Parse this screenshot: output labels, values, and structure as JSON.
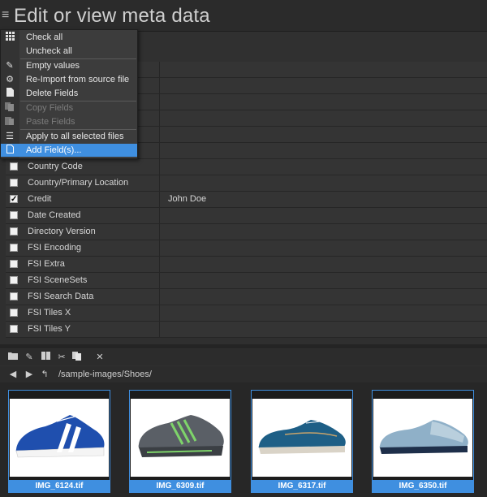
{
  "header": {
    "menu_icon": "hamburger-icon",
    "title": "Edit or view meta data"
  },
  "table": {
    "rows": [
      {
        "name": "",
        "value": "",
        "checked": false
      },
      {
        "name": "",
        "value": "",
        "checked": false
      },
      {
        "name": "",
        "value": "",
        "checked": false
      },
      {
        "name": "",
        "value": "",
        "checked": false
      },
      {
        "name": "",
        "value": "",
        "checked": false
      },
      {
        "name": "",
        "value": "",
        "checked": false
      },
      {
        "name": "Country Code",
        "value": "",
        "checked": false
      },
      {
        "name": "Country/Primary Location",
        "value": "",
        "checked": false
      },
      {
        "name": "Credit",
        "value": "John Doe",
        "checked": true
      },
      {
        "name": "Date Created",
        "value": "",
        "checked": false
      },
      {
        "name": "Directory Version",
        "value": "",
        "checked": false
      },
      {
        "name": "FSI Encoding",
        "value": "",
        "checked": false
      },
      {
        "name": "FSI Extra",
        "value": "",
        "checked": false
      },
      {
        "name": "FSI SceneSets",
        "value": "",
        "checked": false
      },
      {
        "name": "FSI Search Data",
        "value": "",
        "checked": false
      },
      {
        "name": "FSI Tiles X",
        "value": "",
        "checked": false
      },
      {
        "name": "FSI Tiles Y",
        "value": "",
        "checked": false
      }
    ]
  },
  "context_menu": {
    "items": [
      {
        "label": "Check all",
        "icon": "grid-icon",
        "disabled": false
      },
      {
        "label": "Uncheck all",
        "icon": "",
        "disabled": false
      },
      {
        "label": "Empty values",
        "icon": "eraser-icon",
        "disabled": false
      },
      {
        "label": "Re-Import from source file",
        "icon": "gear-icon",
        "disabled": false
      },
      {
        "label": "Delete Fields",
        "icon": "document-icon",
        "disabled": false
      },
      {
        "label": "Copy Fields",
        "icon": "copy-icon",
        "disabled": true
      },
      {
        "label": "Paste Fields",
        "icon": "paste-icon",
        "disabled": true
      },
      {
        "label": "Apply to all selected files",
        "icon": "list-icon",
        "disabled": false
      },
      {
        "label": "Add Field(s)...",
        "icon": "new-document-icon",
        "disabled": false,
        "selected": true
      }
    ]
  },
  "file_browser": {
    "path": "/sample-images/Shoes/",
    "toolbar_icons": [
      "folder-icon",
      "pencil-icon",
      "book-icon",
      "scissors-icon",
      "copy-icon",
      "close-icon"
    ],
    "thumbnails": [
      {
        "filename": "IMG_6124.tif"
      },
      {
        "filename": "IMG_6309.tif"
      },
      {
        "filename": "IMG_6317.tif"
      },
      {
        "filename": "IMG_6350.tif"
      }
    ]
  },
  "colors": {
    "accent": "#3f8fe0",
    "background": "#2f2f2f"
  }
}
